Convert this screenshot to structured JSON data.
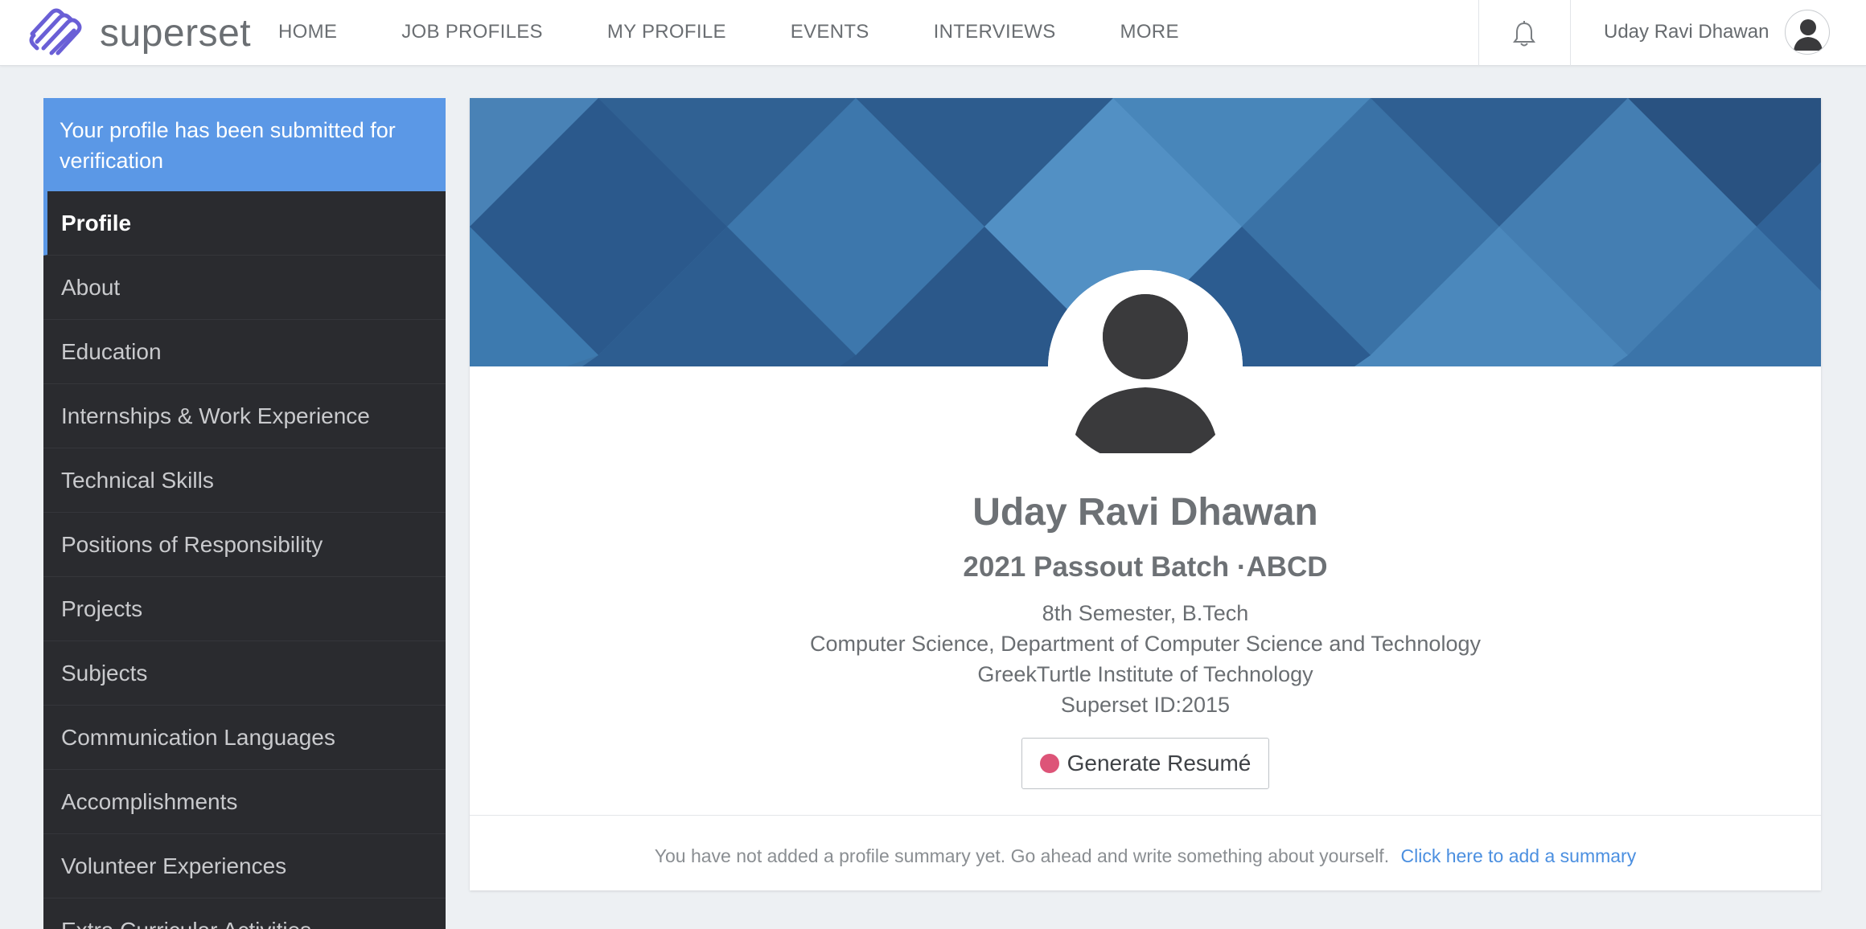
{
  "brand": {
    "name": "superset",
    "logo_icon": "superset-logo-icon"
  },
  "nav": {
    "items": [
      "HOME",
      "JOB PROFILES",
      "MY PROFILE",
      "EVENTS",
      "INTERVIEWS",
      "MORE"
    ]
  },
  "header": {
    "user_name": "Uday Ravi Dhawan",
    "bell_icon": "bell-icon",
    "avatar_icon": "user-avatar-icon"
  },
  "sidebar": {
    "notice": "Your profile has been submitted for verification",
    "items": [
      {
        "label": "Profile",
        "active": true
      },
      {
        "label": "About"
      },
      {
        "label": "Education"
      },
      {
        "label": "Internships & Work Experience"
      },
      {
        "label": "Technical Skills"
      },
      {
        "label": "Positions of Responsibility"
      },
      {
        "label": "Projects"
      },
      {
        "label": "Subjects"
      },
      {
        "label": "Communication Languages"
      },
      {
        "label": "Accomplishments"
      },
      {
        "label": "Volunteer Experiences"
      },
      {
        "label": "Extra Curricular Activities"
      }
    ]
  },
  "profile": {
    "name": "Uday Ravi Dhawan",
    "batch": "2021 Passout Batch ·ABCD",
    "semester": "8th Semester, B.Tech",
    "department": "Computer Science, Department of Computer Science and Technology",
    "institute": "GreekTurtle Institute of Technology",
    "superset_id": "Superset ID:2015",
    "resume_button": "Generate Resumé",
    "summary_note": "You have not added a profile summary yet. Go ahead and write something about yourself.",
    "summary_link": "Click here to add a summary"
  },
  "colors": {
    "accent": "#5b98e6",
    "sidebar_bg": "#2a2b2f",
    "banner": "#3a6f9f",
    "resume_dot": "#dd5478",
    "link": "#4b8fe0"
  }
}
